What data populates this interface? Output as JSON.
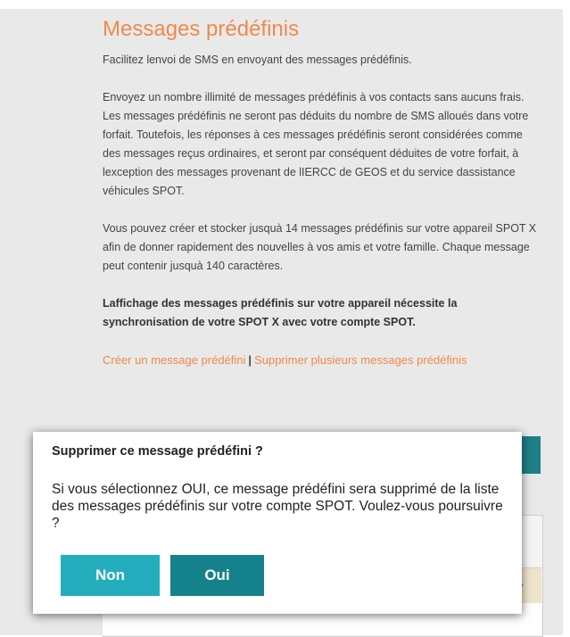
{
  "page": {
    "title": "Messages prédéfinis",
    "intro": "Facilitez lenvoi de SMS en envoyant des messages prédéfinis.",
    "paragraph1": "Envoyez un nombre illimité de messages prédéfinis à vos contacts sans aucuns frais. Les messages prédéfinis ne seront pas déduits du nombre de SMS alloués dans votre forfait. Toutefois, les réponses à ces messages prédéfinis seront considérées comme des messages reçus ordinaires, et seront par conséquent déduites de votre forfait, à lexception des messages provenant de lIERCC de GEOS et du service dassistance véhicules SPOT.",
    "paragraph2": "Vous pouvez créer et stocker jusquà 14 messages prédéfinis sur votre appareil SPOT X afin de donner rapidement des nouvelles à vos amis et votre famille. Chaque message peut contenir jusquà 140 caractères.",
    "paragraph3_bold": "Laffichage des messages prédéfinis sur votre appareil nécessite la synchronisation de votre SPOT X avec votre compte SPOT.",
    "links": {
      "create": "Créer un message prédéfini",
      "separator": "|",
      "delete_multiple": "Supprimer plusieurs messages prédéfinis"
    }
  },
  "modal": {
    "title": "Supprimer ce message prédéfini ?",
    "body": "Si vous sélectionnez OUI, ce message prédéfini sera supprimé de la liste des messages prédéfinis sur votre compte SPOT. Voulez-vous poursuivre ?",
    "no_label": "Non",
    "yes_label": "Oui"
  },
  "colors": {
    "accent_orange": "#f0894b",
    "button_non": "#24aebd",
    "button_oui": "#15828b"
  }
}
